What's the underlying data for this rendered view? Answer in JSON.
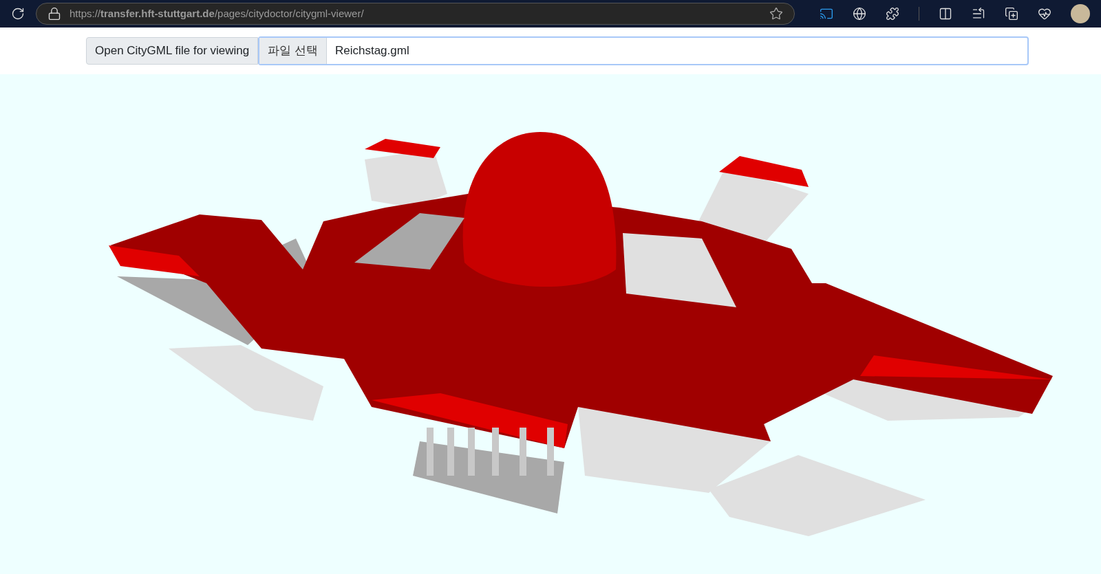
{
  "browser": {
    "url": "https://**transfer.hft-stuttgart.de**/pages/citydoctor/citygml-viewer/"
  },
  "form": {
    "label": "Open CityGML file for viewing",
    "file_button": "파일 선택",
    "file_name": "Reichstag.gml"
  }
}
